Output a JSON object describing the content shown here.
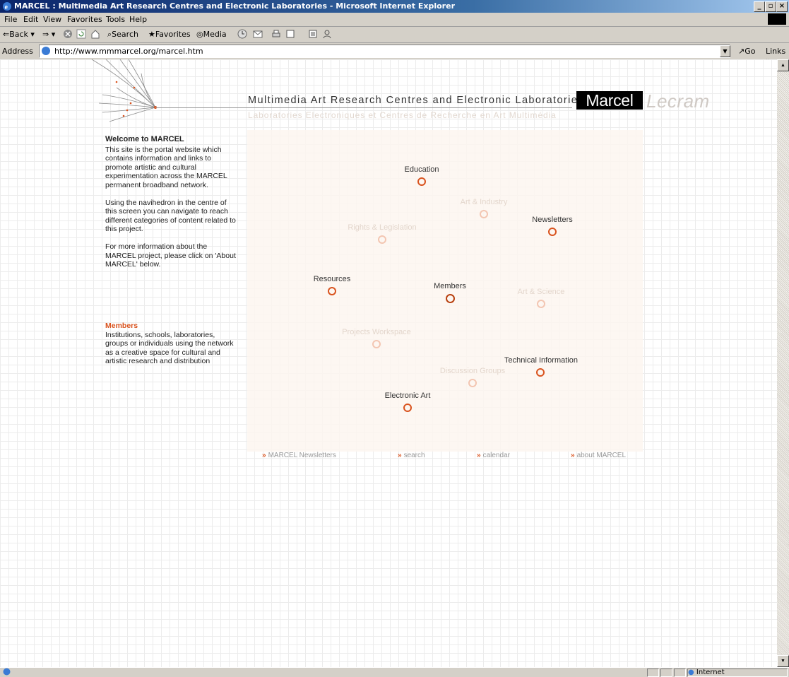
{
  "window": {
    "title": "MARCEL : Multimedia Art Research Centres and Electronic Laboratories - Microsoft Internet Explorer",
    "min": "_",
    "max": "▫",
    "close": "×"
  },
  "menu": [
    "File",
    "Edit",
    "View",
    "Favorites",
    "Tools",
    "Help"
  ],
  "toolbar": {
    "back": "Back",
    "search": "Search",
    "favorites": "Favorites",
    "media": "Media"
  },
  "address": {
    "label": "Address",
    "url": "http://www.mmmarcel.org/marcel.htm",
    "go": "Go",
    "links": "Links"
  },
  "status": {
    "zone": "Internet"
  },
  "page": {
    "headline": "Multimedia Art Research Centres and Electronic Laboratories",
    "subline": "Laboratories Electroniques et Centres de Recherche en Art Multimédia",
    "logo_dark": "Marcel",
    "logo_light": "Lecram",
    "welcome": {
      "title": "Welcome to MARCEL",
      "p1": "This site is the portal website which contains information and links to promote artistic and cultural experimentation across the MARCEL permanent broadband network.",
      "p2": "Using the navihedron in the centre of this screen you can navigate to reach different categories of content related to this project.",
      "p3": "For more information about the MARCEL project, please click on 'About MARCEL' below."
    },
    "members_info": {
      "title": "Members",
      "text": "Institutions, schools, laboratories, groups or individuals using the network as a creative space for cultural and artistic research and distribution"
    },
    "nodes": {
      "education": "Education",
      "art_industry": "Art & Industry",
      "newsletters": "Newsletters",
      "rights": "Rights & Legislation",
      "resources": "Resources",
      "members": "Members",
      "art_science": "Art & Science",
      "projects": "Projects Workspace",
      "technical": "Technical Information",
      "discussion": "Discussion Groups",
      "electronic_art": "Electronic Art"
    },
    "bottom_links": {
      "newsletters": "MARCEL Newsletters",
      "search": "search",
      "calendar": "calendar",
      "about": "about MARCEL",
      "arrow": "»"
    }
  },
  "colors": {
    "accent": "#d9531e",
    "faded_node": "#f3c6b2",
    "faded_text": "#e3d6cc"
  }
}
